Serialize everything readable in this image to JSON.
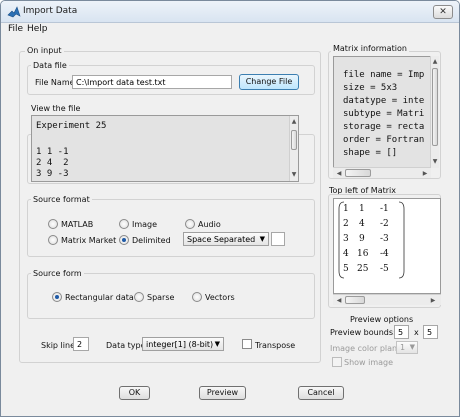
{
  "window": {
    "title": "Import Data",
    "close_glyph": "✕",
    "icon": "matlab-logo-icon"
  },
  "menu": [
    "File",
    "Help"
  ],
  "on_input": {
    "label": "On input",
    "data_file": {
      "label": "Data file",
      "file_name_label": "File Name:",
      "file_name_value": "C:\\Import data test.txt",
      "change_button": "Change File"
    },
    "view_file": {
      "label": "View the file",
      "lines": [
        "Experiment 25",
        "",
        "1 1 -1",
        "2 4  2",
        "3 9 -3"
      ]
    },
    "source_format": {
      "label": "Source format",
      "options": [
        {
          "label": "MATLAB",
          "checked": false
        },
        {
          "label": "Image",
          "checked": false
        },
        {
          "label": "Audio",
          "checked": false
        },
        {
          "label": "Matrix Market",
          "checked": false
        },
        {
          "label": "Delimited",
          "checked": true
        }
      ],
      "delimiter_select": "Space Separated"
    },
    "source_form": {
      "label": "Source form",
      "options": [
        {
          "label": "Rectangular data",
          "checked": true
        },
        {
          "label": "Sparse",
          "checked": false
        },
        {
          "label": "Vectors",
          "checked": false
        }
      ]
    },
    "skip_lines_label": "Skip lines",
    "skip_lines_value": "2",
    "data_type_label": "Data type",
    "data_type_value": "integer[1] (8-bit)",
    "transpose_label": "Transpose"
  },
  "matrix_info": {
    "label": "Matrix information",
    "lines": [
      "file name = Imp",
      "size = 5x3",
      "datatype = inte",
      "subtype = Matri",
      "storage = recta",
      "order = Fortran",
      "shape = []"
    ]
  },
  "top_left": {
    "label": "Top left of Matrix",
    "rows": [
      [
        "1",
        "1",
        "-1"
      ],
      [
        "2",
        "4",
        "-2"
      ],
      [
        "3",
        "9",
        "-3"
      ],
      [
        "4",
        "16",
        "-4"
      ],
      [
        "5",
        "25",
        "-5"
      ]
    ]
  },
  "preview_options": {
    "label": "Preview options",
    "bounds_label": "Preview bounds:",
    "bounds_rows": "5",
    "bounds_x": "x",
    "bounds_cols": "5",
    "color_plane_label": "Image color plane:",
    "color_plane_value": "1",
    "show_image_label": "Show image"
  },
  "buttons": {
    "ok": "OK",
    "preview": "Preview",
    "cancel": "Cancel"
  }
}
